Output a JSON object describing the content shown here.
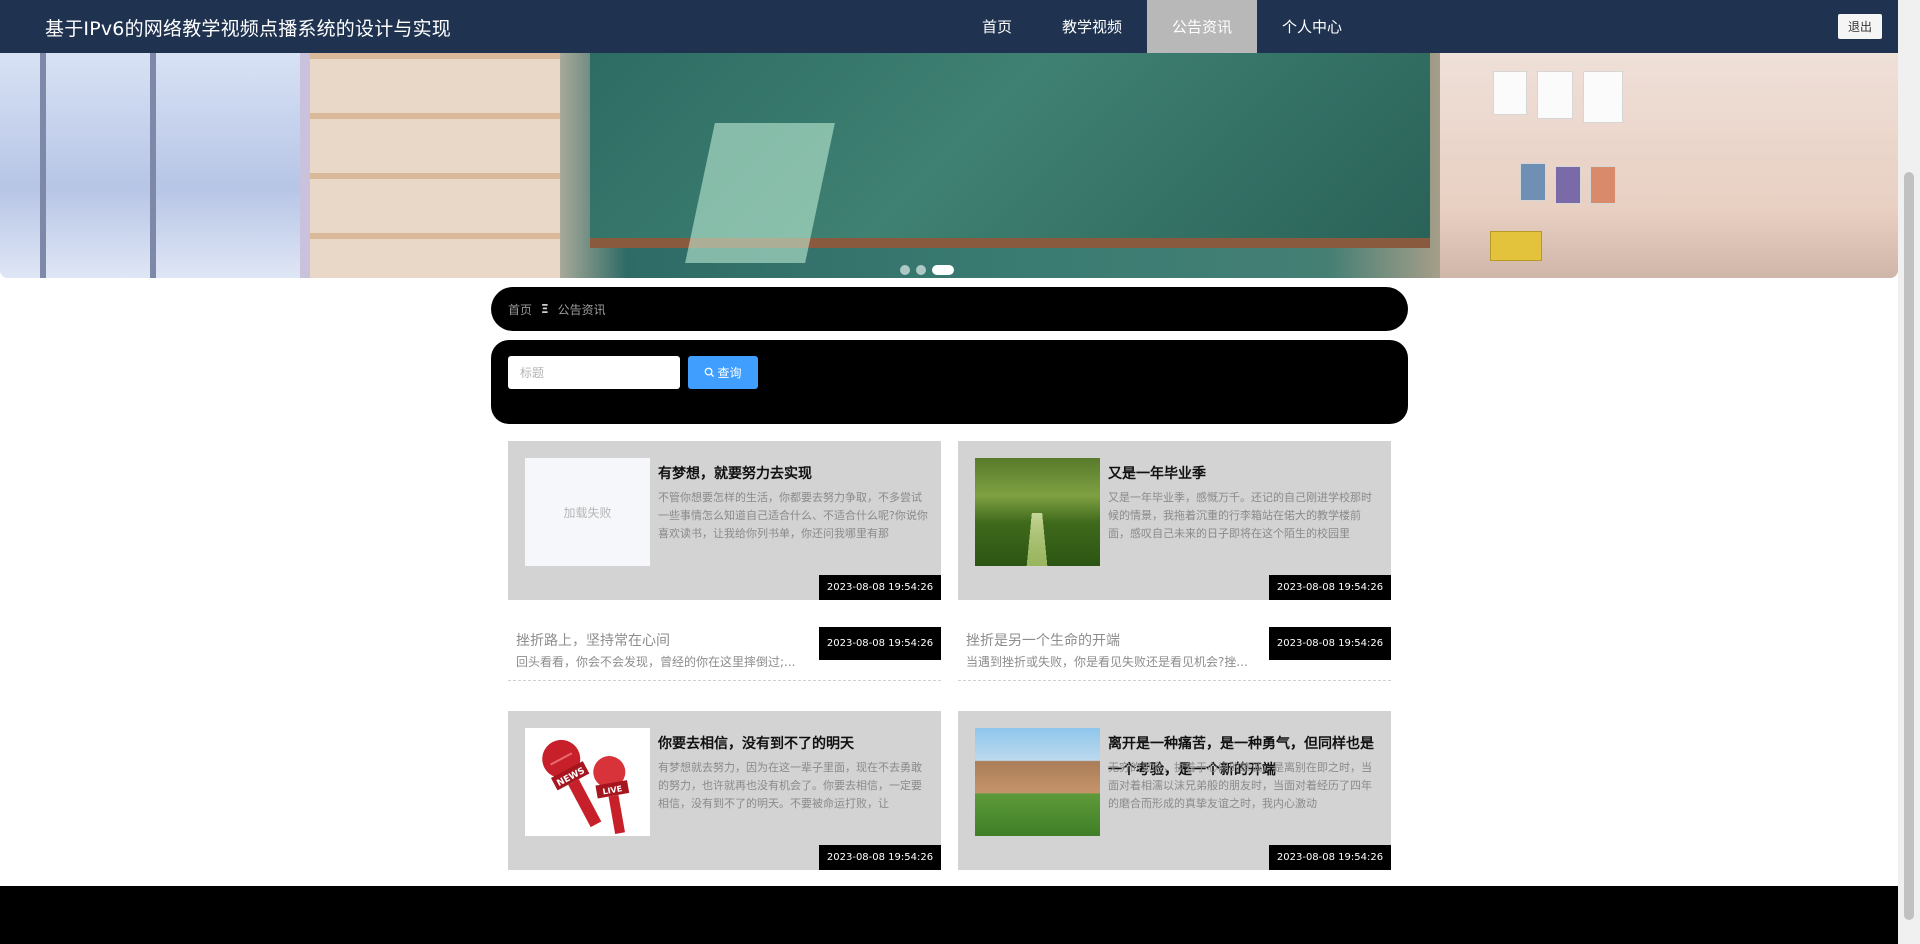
{
  "header": {
    "site_title": "基于IPv6的网络教学视频点播系统的设计与实现",
    "nav": [
      {
        "label": "首页",
        "active": false
      },
      {
        "label": "教学视频",
        "active": false
      },
      {
        "label": "公告资讯",
        "active": true
      },
      {
        "label": "个人中心",
        "active": false
      }
    ],
    "logout_label": "退出"
  },
  "breadcrumb": {
    "home": "首页",
    "separator": "Ξ",
    "current": "公告资讯"
  },
  "search": {
    "placeholder": "标题",
    "value": "",
    "button_label": "查询",
    "button_color": "#409eff"
  },
  "cards": [
    {
      "title": "有梦想，就要努力去实现",
      "desc": "不管你想要怎样的生活，你都要去努力争取，不多尝试一些事情怎么知道自己适合什么、不适合什么呢?你说你喜欢读书，让我给你列书单，你还问我哪里有那",
      "date": "2023-08-08 19:54:26",
      "image": "load-failed",
      "image_text": "加载失败"
    },
    {
      "title": "又是一年毕业季",
      "desc": "又是一年毕业季，感慨万千。还记的自己刚进学校那时候的情景，我拖着沉重的行李箱站在偌大的教学楼前面，感叹自己未来的日子即将在这个陌生的校园里",
      "date": "2023-08-08 19:54:26",
      "image": "tree-lined-path"
    },
    {
      "title": "你要去相信，没有到不了的明天",
      "desc": "有梦想就去努力，因为在这一辈子里面，现在不去勇敢的努力，也许就再也没有机会了。你要去相信，一定要相信，没有到不了的明天。不要被命运打败，让",
      "date": "2023-08-08 19:54:26",
      "image": "news-microphones",
      "mic_labels": [
        "NEWS",
        "LIVE"
      ]
    },
    {
      "title": "离开是一种痛苦，是一种勇气，但同样也是一个考验，是一个新的开端",
      "desc": "无穷的思念，执着于心间的挚诚，是离别在即之时，当面对着相濡以沫兄弟般的朋友时，当面对着经历了四年的磨合而形成的真挚友谊之时，我内心激动",
      "date": "2023-08-08 19:54:26",
      "image": "campus-building"
    }
  ],
  "rows": [
    {
      "title": "挫折路上，坚持常在心间",
      "desc": "回头看看，你会不会发现，曾经的你在这里摔倒过;...",
      "date": "2023-08-08 19:54:26"
    },
    {
      "title": "挫折是另一个生命的开端",
      "desc": "当遇到挫折或失败，你是看见失败还是看见机会?挫...",
      "date": "2023-08-08 19:54:26"
    }
  ],
  "colors": {
    "topbar": "#1f3350",
    "nav_active": "#b8b8b8",
    "card_bg": "#d3d3d3",
    "panel_bg": "#000000"
  }
}
